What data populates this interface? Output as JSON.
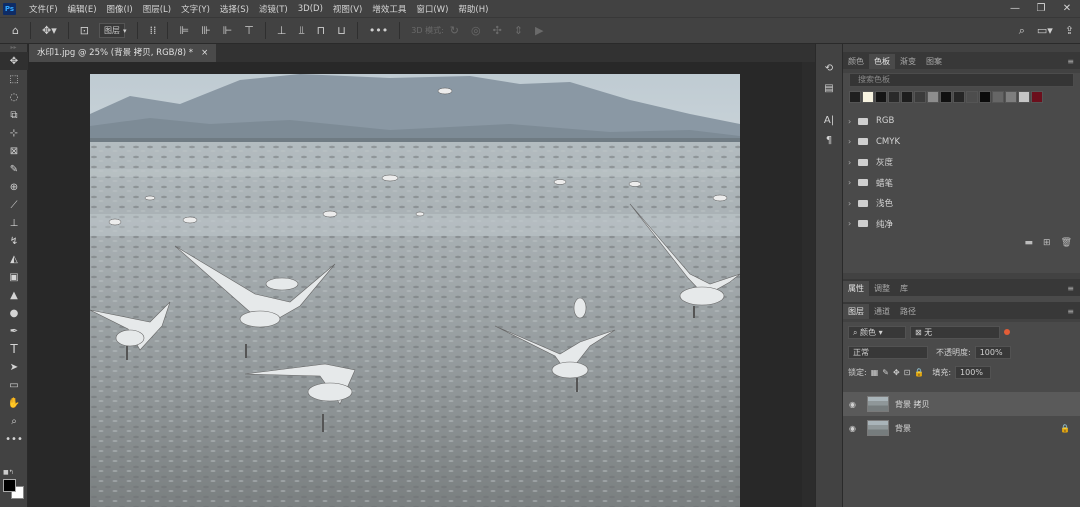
{
  "app": {
    "logo": "Ps"
  },
  "menu": [
    "文件(F)",
    "编辑(E)",
    "图像(I)",
    "图层(L)",
    "文字(Y)",
    "选择(S)",
    "滤镜(T)",
    "3D(D)",
    "视图(V)",
    "增效工具",
    "窗口(W)",
    "帮助(H)"
  ],
  "options": {
    "layer_dropdown": "图层",
    "mode3d_label": "3D 模式:"
  },
  "document": {
    "tab_title": "水印1.jpg @ 25% (背景 拷贝, RGB/8) *",
    "close": "×"
  },
  "swatches_panel": {
    "tabs": [
      "颜色",
      "色板",
      "渐变",
      "图案"
    ],
    "active_tab": "色板",
    "search_placeholder": "搜索色板",
    "swatch_colors": [
      "#1f1f1f",
      "#f7f3e0",
      "#151515",
      "#2a2a2a",
      "#1d1d1d",
      "#3b3b3b",
      "#8d8d8d",
      "#101010",
      "#262626",
      "#4d4d4d",
      "#0b0b0b",
      "#666666",
      "#7e7e7e",
      "#c6c6c6",
      "#6b0f1c"
    ],
    "groups": [
      "RGB",
      "CMYK",
      "灰度",
      "蜡笔",
      "浅色",
      "纯净"
    ]
  },
  "props_tabs": {
    "tabs": [
      "属性",
      "调整",
      "库"
    ],
    "active_tab": "属性"
  },
  "layers_panel": {
    "tabs": [
      "图层",
      "通道",
      "路径"
    ],
    "active_tab": "图层",
    "filter_kind": "颜色",
    "filter_value": "无",
    "blend_mode": "正常",
    "opacity_label": "不透明度:",
    "opacity_value": "100%",
    "lock_label": "锁定:",
    "fill_label": "填充:",
    "fill_value": "100%",
    "layers": [
      {
        "name": "背景 拷贝",
        "selected": true,
        "locked": false
      },
      {
        "name": "背景",
        "selected": false,
        "locked": true
      }
    ]
  },
  "icons": {
    "tools": [
      "move-icon",
      "marquee-icon",
      "lasso-icon",
      "object-select-icon",
      "crop-icon",
      "frame-icon",
      "eyedropper-icon",
      "healing-brush-icon",
      "brush-icon",
      "stamp-icon",
      "history-brush-icon",
      "eraser-icon",
      "gradient-icon",
      "blur-icon",
      "dodge-icon",
      "pen-icon",
      "type-icon",
      "path-select-icon",
      "rectangle-icon",
      "hand-icon",
      "zoom-icon",
      "more-tools-icon"
    ]
  },
  "colors": {
    "foreground": "#000000",
    "background": "#ffffff",
    "accent": "#31a8ff"
  }
}
